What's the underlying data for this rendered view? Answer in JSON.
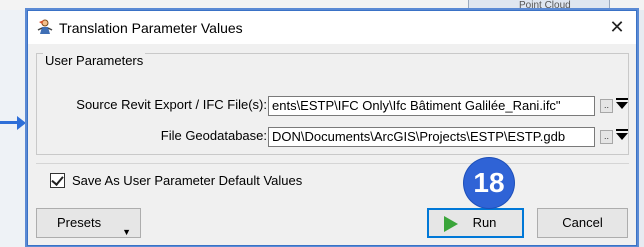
{
  "background": {
    "tab_label": "Point Cloud"
  },
  "dialog": {
    "title": "Translation Parameter Values",
    "close_glyph": "✕",
    "group_title": "User Parameters",
    "params": [
      {
        "label": "Source Revit Export / IFC File(s):",
        "value": "ents\\ESTP\\IFC Only\\Ifc Bâtiment Galilée_Rani.ifc\""
      },
      {
        "label": "File Geodatabase:",
        "value": "DON\\Documents\\ArcGIS\\Projects\\ESTP\\ESTP.gdb"
      }
    ],
    "ellipsis_glyph": "..",
    "save_defaults_label": "Save As User Parameter Default Values",
    "save_defaults_checked": true,
    "buttons": {
      "presets": "Presets",
      "run": "Run",
      "cancel": "Cancel"
    }
  },
  "annotation": {
    "badge_number": "18",
    "badge_color": "#2f63d6",
    "arrow_color": "#2e6fd8"
  }
}
